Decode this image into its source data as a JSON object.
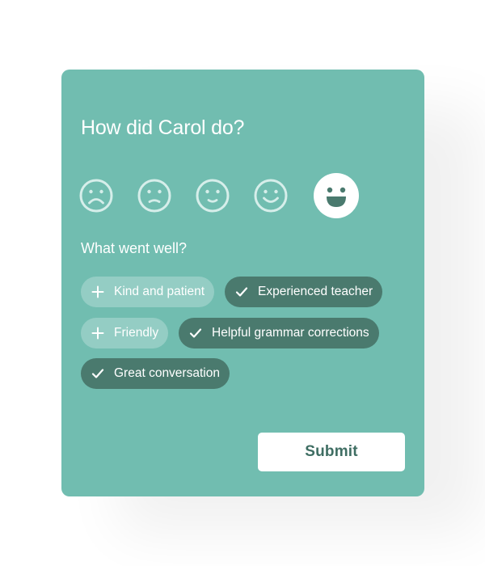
{
  "colors": {
    "card_background": "#71bdb0",
    "chip_unselected": "#94cdc4",
    "chip_selected": "#4a7a6e",
    "face_outline": "#d6eeea",
    "submit_text": "#3f6e63"
  },
  "rating": {
    "title": "How did Carol do?",
    "options": [
      {
        "label": "very-sad",
        "icon": "very-sad-face-icon",
        "selected": false
      },
      {
        "label": "sad",
        "icon": "sad-face-icon",
        "selected": false
      },
      {
        "label": "neutral",
        "icon": "slight-smile-face-icon",
        "selected": false
      },
      {
        "label": "happy",
        "icon": "smile-face-icon",
        "selected": false
      },
      {
        "label": "very-happy",
        "icon": "big-grin-face-icon",
        "selected": true
      }
    ],
    "selected_value": 5,
    "max_value": 5
  },
  "feedback": {
    "question": "What went well?",
    "tags": [
      {
        "label": "Kind and patient",
        "selected": false,
        "icon": "plus-icon"
      },
      {
        "label": "Experienced teacher",
        "selected": true,
        "icon": "check-icon"
      },
      {
        "label": "Friendly",
        "selected": false,
        "icon": "plus-icon"
      },
      {
        "label": "Helpful grammar corrections",
        "selected": true,
        "icon": "check-icon"
      },
      {
        "label": "Great conversation",
        "selected": true,
        "icon": "check-icon"
      }
    ]
  },
  "actions": {
    "submit_label": "Submit"
  }
}
